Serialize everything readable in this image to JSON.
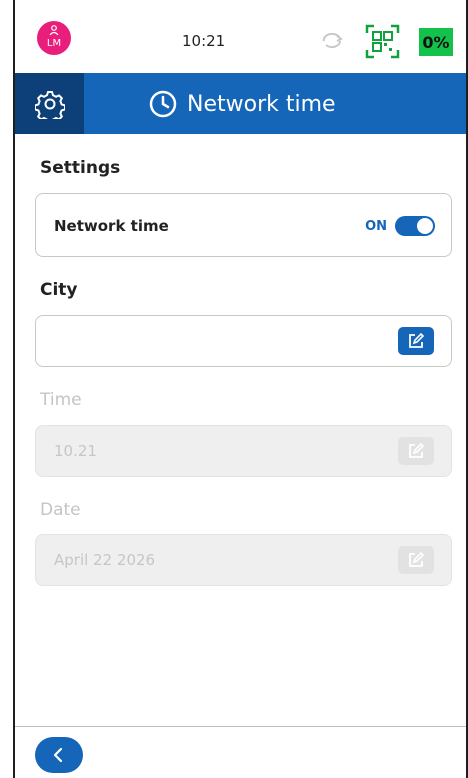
{
  "status_bar": {
    "avatar_initials": "LM",
    "time": "10:21",
    "battery": "0%",
    "battery_color": "#12c24a",
    "avatar_color": "#e91e7c"
  },
  "header": {
    "title": "Network time",
    "icon": "clock-icon",
    "settings_icon": "gear-icon",
    "color": "#1565b8"
  },
  "settings": {
    "label": "Settings",
    "network_time_label": "Network time",
    "toggle_state": "ON"
  },
  "city": {
    "label": "City",
    "value": ""
  },
  "time": {
    "label": "Time",
    "value": "10.21",
    "disabled": true
  },
  "date": {
    "label": "Date",
    "value": "April 22 2026",
    "disabled": true
  },
  "footer": {
    "back_icon": "chevron-left-icon"
  }
}
